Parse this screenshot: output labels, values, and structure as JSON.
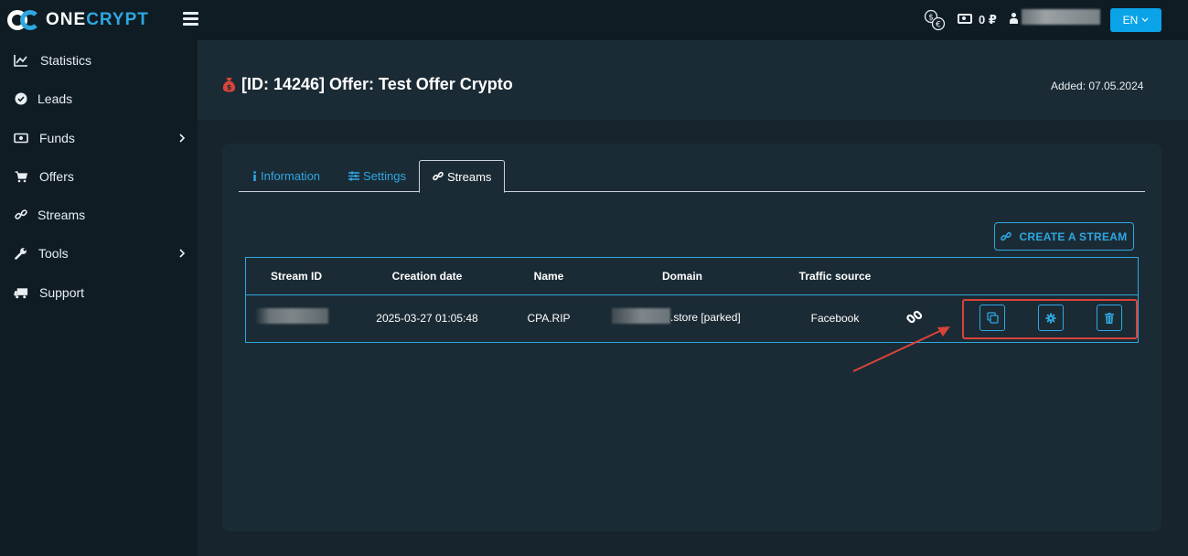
{
  "brand": {
    "part1": "ONE",
    "part2": "CRYPT"
  },
  "header": {
    "balance": "0 ₽",
    "language": "EN"
  },
  "sidebar": {
    "items": [
      {
        "label": "Statistics",
        "icon": "chart-line-icon"
      },
      {
        "label": "Leads",
        "icon": "check-circle-icon"
      },
      {
        "label": "Funds",
        "icon": "money-icon",
        "has_submenu": true
      },
      {
        "label": "Offers",
        "icon": "cart-icon"
      },
      {
        "label": "Streams",
        "icon": "link-icon"
      },
      {
        "label": "Tools",
        "icon": "wrench-icon",
        "has_submenu": true
      },
      {
        "label": "Support",
        "icon": "truck-icon"
      }
    ]
  },
  "page": {
    "title": "[ID: 14246] Offer: Test Offer Crypto",
    "added": "Added: 07.05.2024"
  },
  "tabs": [
    {
      "label": "Information",
      "icon": "info-icon",
      "active": false
    },
    {
      "label": "Settings",
      "icon": "sliders-icon",
      "active": false
    },
    {
      "label": "Streams",
      "icon": "link-icon",
      "active": true
    }
  ],
  "create_button": "CREATE A STREAM",
  "table": {
    "columns": [
      "Stream ID",
      "Creation date",
      "Name",
      "Domain",
      "Traffic source"
    ],
    "rows": [
      {
        "creation_date": "2025-03-27 01:05:48",
        "name": "CPA.RIP",
        "domain_suffix": ".store [parked]",
        "traffic_source": "Facebook"
      }
    ]
  },
  "colors": {
    "accent": "#2ea7e0",
    "highlight": "#d9433a",
    "lang_button": "#0aa3e8"
  }
}
